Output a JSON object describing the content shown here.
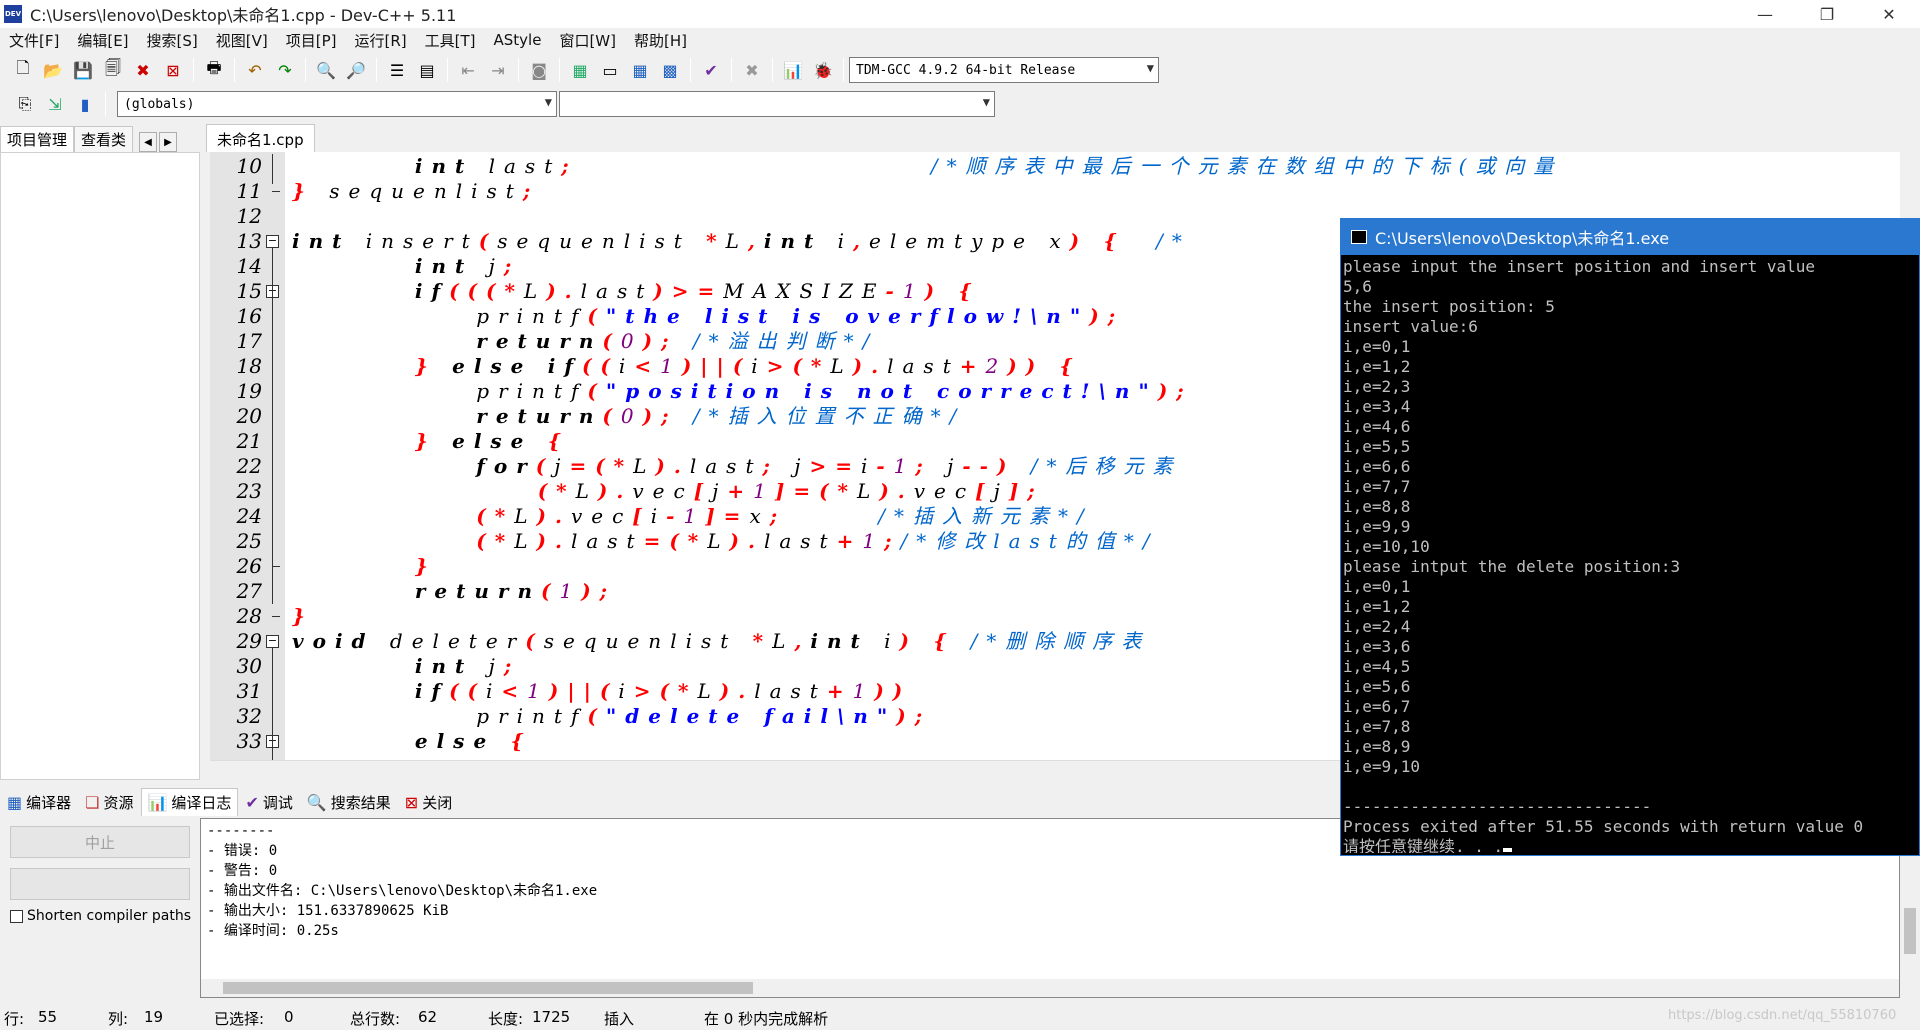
{
  "window": {
    "title": "C:\\Users\\lenovo\\Desktop\\未命名1.cpp - Dev-C++ 5.11",
    "minimize": "—",
    "restore": "❐",
    "close": "✕"
  },
  "menu": [
    "文件[F]",
    "编辑[E]",
    "搜索[S]",
    "视图[V]",
    "项目[P]",
    "运行[R]",
    "工具[T]",
    "AStyle",
    "窗口[W]",
    "帮助[H]"
  ],
  "toolbar": {
    "compiler": "TDM-GCC 4.9.2 64-bit Release",
    "scope": "(globals)",
    "function": ""
  },
  "left_tabs": [
    "项目管理",
    "查看类"
  ],
  "editor_tab": "未命名1.cpp",
  "code_lines": [
    {
      "n": "10",
      "html": "        <span class=\"kw\">int</span> last<span class=\"sym\">;</span>                       <span class=\"cmt\">/*顺序表中最后一个元素在数组中的下标(或向量</span>"
    },
    {
      "n": "11",
      "html": "<span class=\"sym\">}</span> sequenlist<span class=\"sym\">;</span>"
    },
    {
      "n": "12",
      "html": ""
    },
    {
      "n": "13",
      "html": "<span class=\"kw\">int</span> insert<span class=\"sym\">(</span>sequenlist <span class=\"sym\">*</span>L<span class=\"sym\">,</span><span class=\"kw\">int</span> i<span class=\"sym\">,</span>elemtype x<span class=\"sym\">)</span> <span class=\"sym\">{</span>  <span class=\"cmt\">/*</span>"
    },
    {
      "n": "14",
      "html": "        <span class=\"kw\">int</span> j<span class=\"sym\">;</span>"
    },
    {
      "n": "15",
      "html": "        <span class=\"kw\">if</span><span class=\"sym\">(((*</span>L<span class=\"sym\">).</span>last<span class=\"sym\">)>=</span>MAXSIZE<span class=\"sym\">-</span><span class=\"num\">1</span><span class=\"sym\">)</span> <span class=\"sym\">{</span>"
    },
    {
      "n": "16",
      "html": "            printf<span class=\"sym\">(</span><span class=\"str\">\"the list is overflow!\\n\"</span><span class=\"sym\">);</span>"
    },
    {
      "n": "17",
      "html": "            <span class=\"kw\">return</span><span class=\"sym\">(</span><span class=\"num\">0</span><span class=\"sym\">);</span> <span class=\"cmt\">/*溢出判断*/</span>"
    },
    {
      "n": "18",
      "html": "        <span class=\"sym\">}</span> <span class=\"kw\">else</span> <span class=\"kw\">if</span><span class=\"sym\">((</span>i<span class=\"sym\"><</span><span class=\"num\">1</span><span class=\"sym\">)||(</span>i<span class=\"sym\">>(*</span>L<span class=\"sym\">).</span>last<span class=\"sym\">+</span><span class=\"num\">2</span><span class=\"sym\">))</span> <span class=\"sym\">{</span>"
    },
    {
      "n": "19",
      "html": "            printf<span class=\"sym\">(</span><span class=\"str\">\"position is not correct!\\n\"</span><span class=\"sym\">);</span>"
    },
    {
      "n": "20",
      "html": "            <span class=\"kw\">return</span><span class=\"sym\">(</span><span class=\"num\">0</span><span class=\"sym\">);</span> <span class=\"cmt\">/*插入位置不正确*/</span>"
    },
    {
      "n": "21",
      "html": "        <span class=\"sym\">}</span> <span class=\"kw\">else</span> <span class=\"sym\">{</span>"
    },
    {
      "n": "22",
      "html": "            <span class=\"kw\">for</span><span class=\"sym\">(</span>j<span class=\"sym\">=(*</span>L<span class=\"sym\">).</span>last<span class=\"sym\">;</span> j<span class=\"sym\">>=</span>i<span class=\"sym\">-</span><span class=\"num\">1</span><span class=\"sym\">;</span> j<span class=\"sym\">--)</span> <span class=\"cmt\">/*后移元素</span>"
    },
    {
      "n": "23",
      "html": "                <span class=\"sym\">(*</span>L<span class=\"sym\">).</span>vec<span class=\"sym\">[</span>j<span class=\"sym\">+</span><span class=\"num\">1</span><span class=\"sym\">]=(*</span>L<span class=\"sym\">).</span>vec<span class=\"sym\">[</span>j<span class=\"sym\">];</span>"
    },
    {
      "n": "24",
      "html": "            <span class=\"sym\">(*</span>L<span class=\"sym\">).</span>vec<span class=\"sym\">[</span>i<span class=\"sym\">-</span><span class=\"num\">1</span><span class=\"sym\">]=</span>x<span class=\"sym\">;</span>      <span class=\"cmt\">/*插入新元素*/</span>"
    },
    {
      "n": "25",
      "html": "            <span class=\"sym\">(*</span>L<span class=\"sym\">).</span>last<span class=\"sym\">=(*</span>L<span class=\"sym\">).</span>last<span class=\"sym\">+</span><span class=\"num\">1</span><span class=\"sym\">;</span><span class=\"cmt\">/*修改last的值*/</span>"
    },
    {
      "n": "26",
      "html": "        <span class=\"sym\">}</span>"
    },
    {
      "n": "27",
      "html": "        <span class=\"kw\">return</span><span class=\"sym\">(</span><span class=\"num\">1</span><span class=\"sym\">);</span>"
    },
    {
      "n": "28",
      "html": "<span class=\"sym\">}</span>"
    },
    {
      "n": "29",
      "html": "<span class=\"kw\">void</span> deleter<span class=\"sym\">(</span>sequenlist <span class=\"sym\">*</span>L<span class=\"sym\">,</span><span class=\"kw\">int</span> i<span class=\"sym\">)</span> <span class=\"sym\">{</span> <span class=\"cmt\">/*删除顺序表</span>"
    },
    {
      "n": "30",
      "html": "        <span class=\"kw\">int</span> j<span class=\"sym\">;</span>"
    },
    {
      "n": "31",
      "html": "        <span class=\"kw\">if</span><span class=\"sym\">((</span>i<span class=\"sym\"><</span><span class=\"num\">1</span><span class=\"sym\">)||(</span>i<span class=\"sym\">>(*</span>L<span class=\"sym\">).</span>last<span class=\"sym\">+</span><span class=\"num\">1</span><span class=\"sym\">))</span>"
    },
    {
      "n": "32",
      "html": "            printf<span class=\"sym\">(</span><span class=\"str\">\"delete fail\\n\"</span><span class=\"sym\">);</span>"
    },
    {
      "n": "33",
      "html": "        <span class=\"kw\">else</span> <span class=\"sym\">{</span>"
    }
  ],
  "bottom_tabs": [
    "编译器",
    "资源",
    "编译日志",
    "调试",
    "搜索结果",
    "关闭"
  ],
  "bottom_left": {
    "stop_button": "中止",
    "shorten_label": "Shorten compiler paths"
  },
  "log_lines": [
    "--------",
    "- 错误: 0",
    "- 警告: 0",
    "- 输出文件名: C:\\Users\\lenovo\\Desktop\\未命名1.exe",
    "- 输出大小: 151.6337890625 KiB",
    "- 编译时间: 0.25s"
  ],
  "status": {
    "row_label": "行:",
    "row": "55",
    "col_label": "列:",
    "col": "19",
    "sel_label": "已选择:",
    "sel": "0",
    "total_label": "总行数:",
    "total": "62",
    "len_label": "长度:",
    "len": "1725",
    "mode": "插入",
    "parse": "在 0 秒内完成解析",
    "watermark": "https://blog.csdn.net/qq_55810760"
  },
  "console": {
    "title": "C:\\Users\\lenovo\\Desktop\\未命名1.exe",
    "lines": [
      "please input the insert position and insert value",
      "5,6",
      "the insert position: 5",
      "insert value:6",
      "i,e=0,1",
      "i,e=1,2",
      "i,e=2,3",
      "i,e=3,4",
      "i,e=4,6",
      "i,e=5,5",
      "i,e=6,6",
      "i,e=7,7",
      "i,e=8,8",
      "i,e=9,9",
      "i,e=10,10",
      "please intput the delete position:3",
      "i,e=0,1",
      "i,e=1,2",
      "i,e=2,4",
      "i,e=3,6",
      "i,e=4,5",
      "i,e=5,6",
      "i,e=6,7",
      "i,e=7,8",
      "i,e=8,9",
      "i,e=9,10",
      "",
      "--------------------------------",
      "Process exited after 51.55 seconds with return value 0",
      "请按任意键继续. . ."
    ]
  }
}
